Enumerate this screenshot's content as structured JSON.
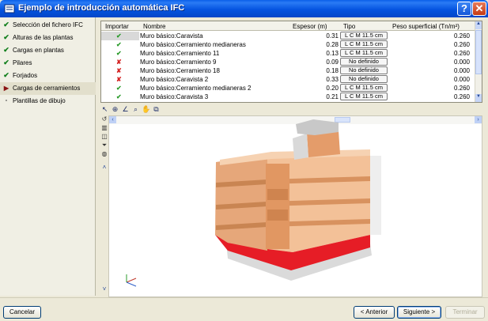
{
  "window": {
    "title": "Ejemplo de introducción automática IFC",
    "help_label": "?",
    "close_label": "✕"
  },
  "sidebar": {
    "items": [
      {
        "label": "Selección del fichero IFC",
        "state": "done",
        "mark": "✔"
      },
      {
        "label": "Alturas de las plantas",
        "state": "done",
        "mark": "✔"
      },
      {
        "label": "Cargas en plantas",
        "state": "done",
        "mark": "✔"
      },
      {
        "label": "Pilares",
        "state": "done",
        "mark": "✔"
      },
      {
        "label": "Forjados",
        "state": "done",
        "mark": "✔"
      },
      {
        "label": "Cargas de cerramientos",
        "state": "current",
        "mark": "▶"
      },
      {
        "label": "Plantillas de dibujo",
        "state": "pending",
        "mark": "-"
      }
    ]
  },
  "table": {
    "columns": [
      "Importar",
      "Nombre",
      "Espesor (m)",
      "Tipo",
      "Peso superficial (Tn/m²)"
    ],
    "rows": [
      {
        "import": true,
        "name": "Muro básico:Caravista",
        "espesor": "0.31",
        "tipo": "L C M 11.5 cm",
        "peso": "0.260"
      },
      {
        "import": true,
        "name": "Muro básico:Cerramiento medianeras",
        "espesor": "0.28",
        "tipo": "L C M 11.5 cm",
        "peso": "0.260"
      },
      {
        "import": true,
        "name": "Muro básico:Cerramiento 11",
        "espesor": "0.13",
        "tipo": "L C M 11.5 cm",
        "peso": "0.260"
      },
      {
        "import": false,
        "name": "Muro básico:Cerramiento 9",
        "espesor": "0.09",
        "tipo": "No definido",
        "peso": "0.000"
      },
      {
        "import": false,
        "name": "Muro básico:Cerramiento 18",
        "espesor": "0.18",
        "tipo": "No definido",
        "peso": "0.000"
      },
      {
        "import": false,
        "name": "Muro básico:Caravista 2",
        "espesor": "0.33",
        "tipo": "No definido",
        "peso": "0.000"
      },
      {
        "import": true,
        "name": "Muro básico:Cerramiento medianeras 2",
        "espesor": "0.20",
        "tipo": "L C M 11.5 cm",
        "peso": "0.260"
      },
      {
        "import": true,
        "name": "Muro básico:Caravista 3",
        "espesor": "0.21",
        "tipo": "L C M 11.5 cm",
        "peso": "0.260"
      }
    ]
  },
  "viewer": {
    "scroll_left": "‹",
    "scroll_right": "›"
  },
  "footer": {
    "cancel_label": "Cancelar",
    "back_label": "< Anterior",
    "next_label": "Siguiente >",
    "finish_label": "Terminar"
  },
  "colors": {
    "wall": "#E8A877",
    "wall_red": "#E61D26",
    "accent": "#0A5FE8"
  }
}
